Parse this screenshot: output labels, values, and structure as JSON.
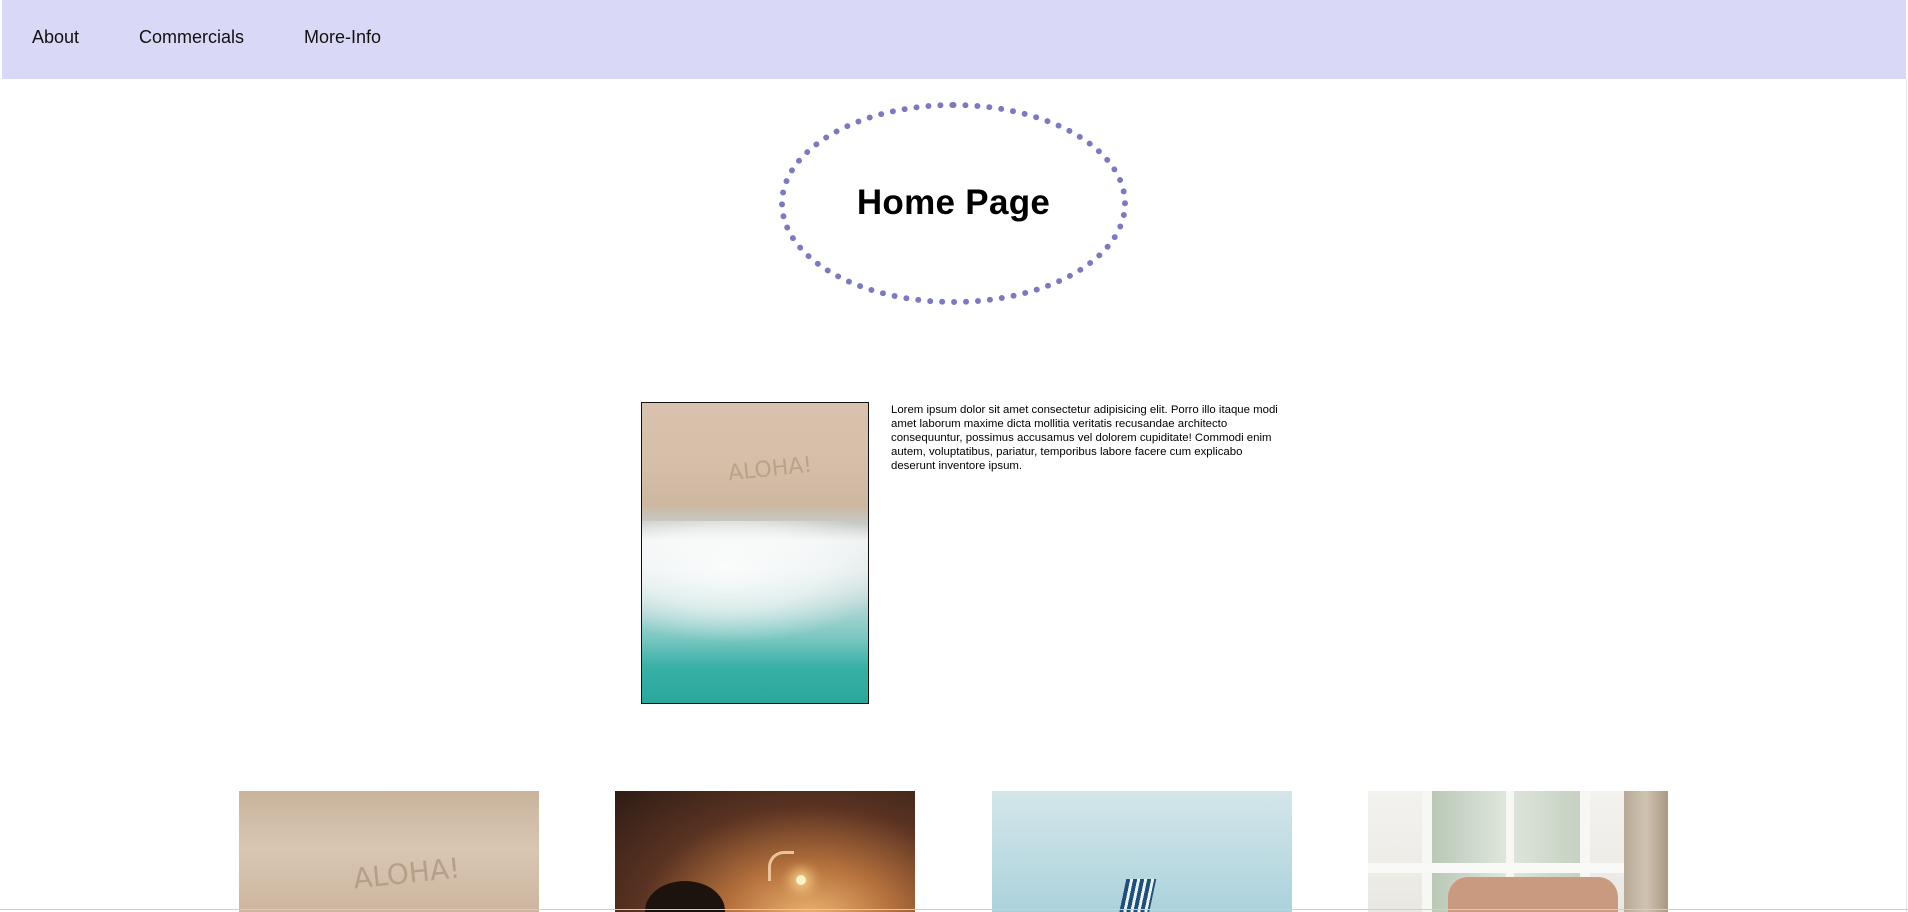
{
  "nav": {
    "items": [
      {
        "label": "About"
      },
      {
        "label": "Commercials"
      },
      {
        "label": "More-Info"
      }
    ]
  },
  "header": {
    "title": "Home Page"
  },
  "feature": {
    "image_alt": "ALOHA!",
    "text": "Lorem ipsum dolor sit amet consectetur adipisicing elit. Porro illo itaque modi amet laborum maxime dicta mollitia veritatis recusandae architecto consequuntur, possimus accusamus vel dolorem cupiditate! Commodi enim autem, voluptatibus, pariatur, temporibus labore facere cum explicabo deserunt inventore ipsum."
  },
  "gallery": {
    "thumbs": [
      {
        "sand_text": "ALOHA!"
      },
      {
        "subject": "lamp"
      },
      {
        "subject": "beach-chair"
      },
      {
        "subject": "window"
      }
    ]
  },
  "colors": {
    "nav_background": "#d9d9f7",
    "oval_border": "#7b79c2"
  }
}
